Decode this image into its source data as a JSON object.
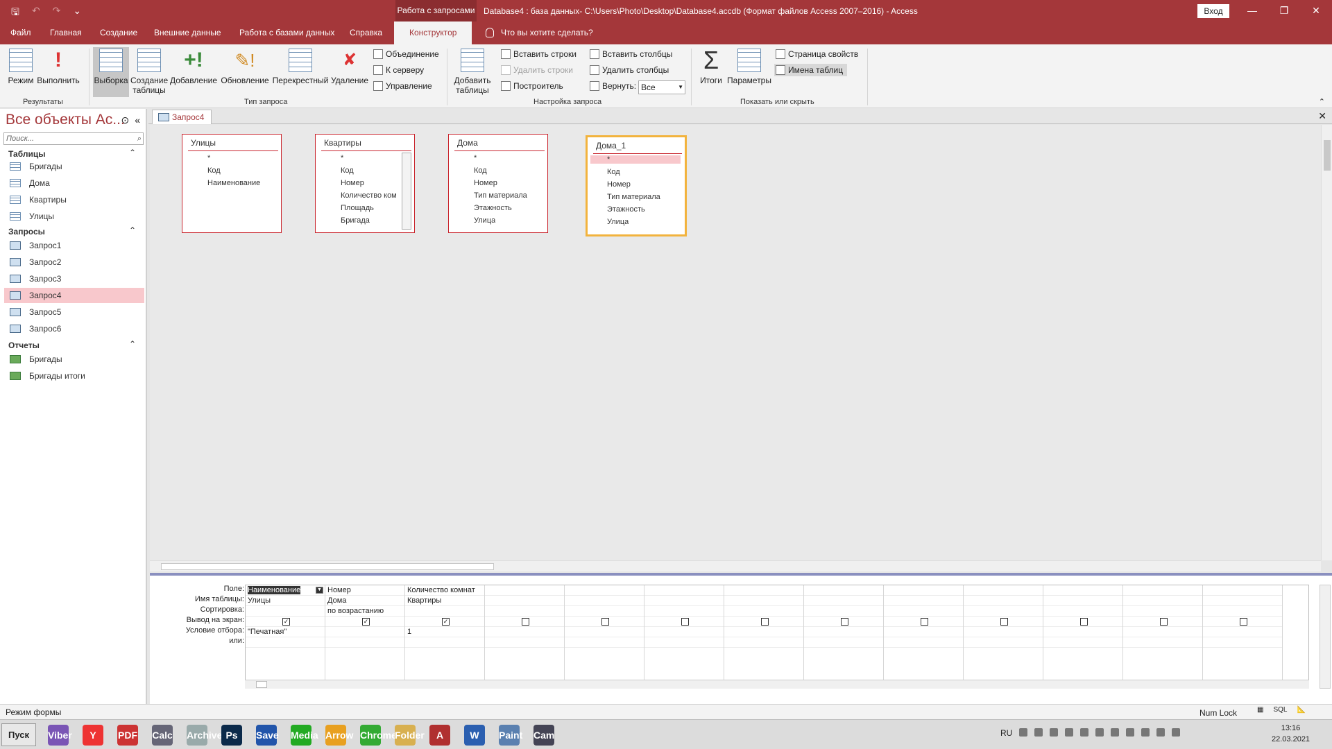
{
  "titlebar": {
    "qat_icons": [
      "save-icon",
      "undo-icon",
      "redo-icon",
      "customize-qat-icon"
    ],
    "context_tab_title": "Работа с запросами",
    "doc_title": "Database4 : база данных- C:\\Users\\Photo\\Desktop\\Database4.accdb (Формат файлов Access 2007–2016)  -  Access",
    "signin": "Вход",
    "window_buttons": [
      "—",
      "❐",
      "✕"
    ]
  },
  "tabs": [
    "Файл",
    "Главная",
    "Создание",
    "Внешние данные",
    "Работа с базами данных",
    "Справка",
    "Конструктор"
  ],
  "active_tab": "Конструктор",
  "tell_me": "Что вы хотите сделать?",
  "ribbon": {
    "results": {
      "label": "Результаты",
      "mode": "Режим",
      "run": "Выполнить"
    },
    "query_type": {
      "label": "Тип запроса",
      "select": "Выборка",
      "make_table_1": "Создание",
      "make_table_2": "таблицы",
      "append": "Добавление",
      "update": "Обновление",
      "crosstab": "Перекрестный",
      "delete": "Удаление",
      "union": "Объединение",
      "passthrough": "К серверу",
      "ddl": "Управление"
    },
    "setup": {
      "label": "Настройка запроса",
      "add_tables_1": "Добавить",
      "add_tables_2": "таблицы",
      "insert_rows": "Вставить строки",
      "delete_rows": "Удалить строки",
      "builder": "Построитель",
      "insert_cols": "Вставить столбцы",
      "delete_cols": "Удалить столбцы",
      "return_label": "Вернуть:",
      "return_value": "Все"
    },
    "show_hide": {
      "label": "Показать или скрыть",
      "totals": "Итоги",
      "params": "Параметры",
      "prop_sheet": "Страница свойств",
      "table_names": "Имена таблиц"
    }
  },
  "nav": {
    "title": "Все объекты Ac...",
    "search_placeholder": "Поиск...",
    "sections": [
      {
        "label": "Таблицы",
        "items": [
          "Бригады",
          "Дома",
          "Квартиры",
          "Улицы"
        ]
      },
      {
        "label": "Запросы",
        "items": [
          "Запрос1",
          "Запрос2",
          "Запрос3",
          "Запрос4",
          "Запрос5",
          "Запрос6"
        ]
      },
      {
        "label": "Отчеты",
        "items": [
          "Бригады",
          "Бригады итоги"
        ]
      }
    ],
    "selected": "Запрос4"
  },
  "doc_tab": "Запрос4",
  "field_lists": [
    {
      "title": "Улицы",
      "fields": [
        "*",
        "Код",
        "Наименование"
      ]
    },
    {
      "title": "Квартиры",
      "fields": [
        "*",
        "Код",
        "Номер",
        "Количество ком",
        "Площадь",
        "Бригада"
      ]
    },
    {
      "title": "Дома",
      "fields": [
        "*",
        "Код",
        "Номер",
        "Тип материала",
        "Этажность",
        "Улица"
      ]
    },
    {
      "title": "Дома_1",
      "fields": [
        "*",
        "Код",
        "Номер",
        "Тип материала",
        "Этажность",
        "Улица"
      ]
    }
  ],
  "qbe": {
    "row_labels": [
      "Поле:",
      "Имя таблицы:",
      "Сортировка:",
      "Вывод на экран:",
      "Условие отбора:",
      "или:"
    ],
    "columns": [
      {
        "field": "Наименование",
        "table": "Улицы",
        "sort": "",
        "show": true,
        "criteria": "\"Печатная\""
      },
      {
        "field": "Номер",
        "table": "Дома",
        "sort": "по возрастанию",
        "show": true,
        "criteria": ""
      },
      {
        "field": "Количество комнат",
        "table": "Квартиры",
        "sort": "",
        "show": true,
        "criteria": "1"
      }
    ],
    "empty_columns": 10
  },
  "status": {
    "left": "Режим формы",
    "numlock": "Num Lock",
    "views": [
      "datasheet-view-icon",
      "SQL",
      "design-view-icon"
    ]
  },
  "taskbar": {
    "start": "Пуск",
    "apps": [
      "Viber",
      "Y",
      "PDF",
      "Calc",
      "Archive",
      "Ps",
      "Save",
      "Media",
      "Arrow",
      "Chrome",
      "Folder",
      "A",
      "W",
      "Paint",
      "Cam"
    ],
    "lang": "RU",
    "time": "13:16",
    "date": "22.03.2021"
  }
}
